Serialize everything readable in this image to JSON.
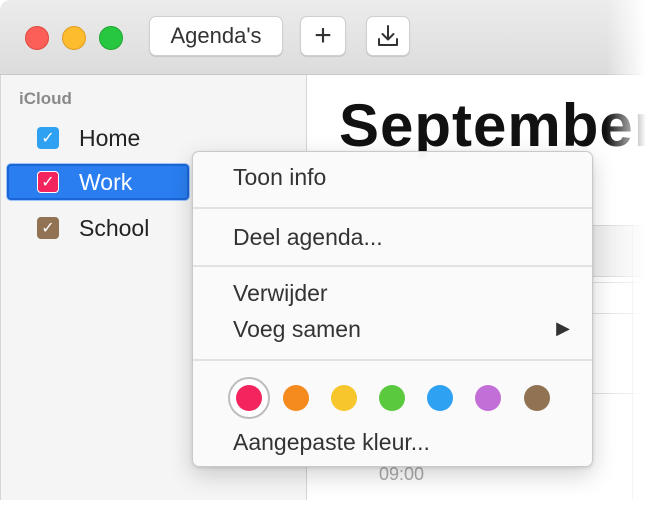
{
  "toolbar": {
    "calendars_label": "Agenda's",
    "add_label": "+",
    "download_icon": "download-icon"
  },
  "sidebar": {
    "header": "iCloud",
    "items": [
      {
        "label": "Home",
        "color": "#2ea1f2",
        "checked": true,
        "selected": false
      },
      {
        "label": "Work",
        "color": "#f3245e",
        "checked": true,
        "selected": true
      },
      {
        "label": "School",
        "color": "#917354",
        "checked": true,
        "selected": false
      }
    ]
  },
  "main": {
    "month_title": "September",
    "time_label": "09:00"
  },
  "context_menu": {
    "show_info": "Toon info",
    "share_calendar": "Deel agenda...",
    "delete": "Verwijder",
    "merge": "Voeg samen",
    "merge_arrow": "▶",
    "custom_color": "Aangepaste kleur...",
    "colors": [
      {
        "name": "red",
        "hex": "#f3245e",
        "selected": true
      },
      {
        "name": "orange",
        "hex": "#f58a1f"
      },
      {
        "name": "yellow",
        "hex": "#f7c52c"
      },
      {
        "name": "green",
        "hex": "#5ac93e"
      },
      {
        "name": "blue",
        "hex": "#2ea1f2"
      },
      {
        "name": "purple",
        "hex": "#c36fd8"
      },
      {
        "name": "brown",
        "hex": "#917354"
      }
    ]
  },
  "colors": {
    "selection": "#2a7ef0",
    "close": "#fc5f57",
    "minimize": "#fdbb2e",
    "maximize": "#27c840"
  }
}
